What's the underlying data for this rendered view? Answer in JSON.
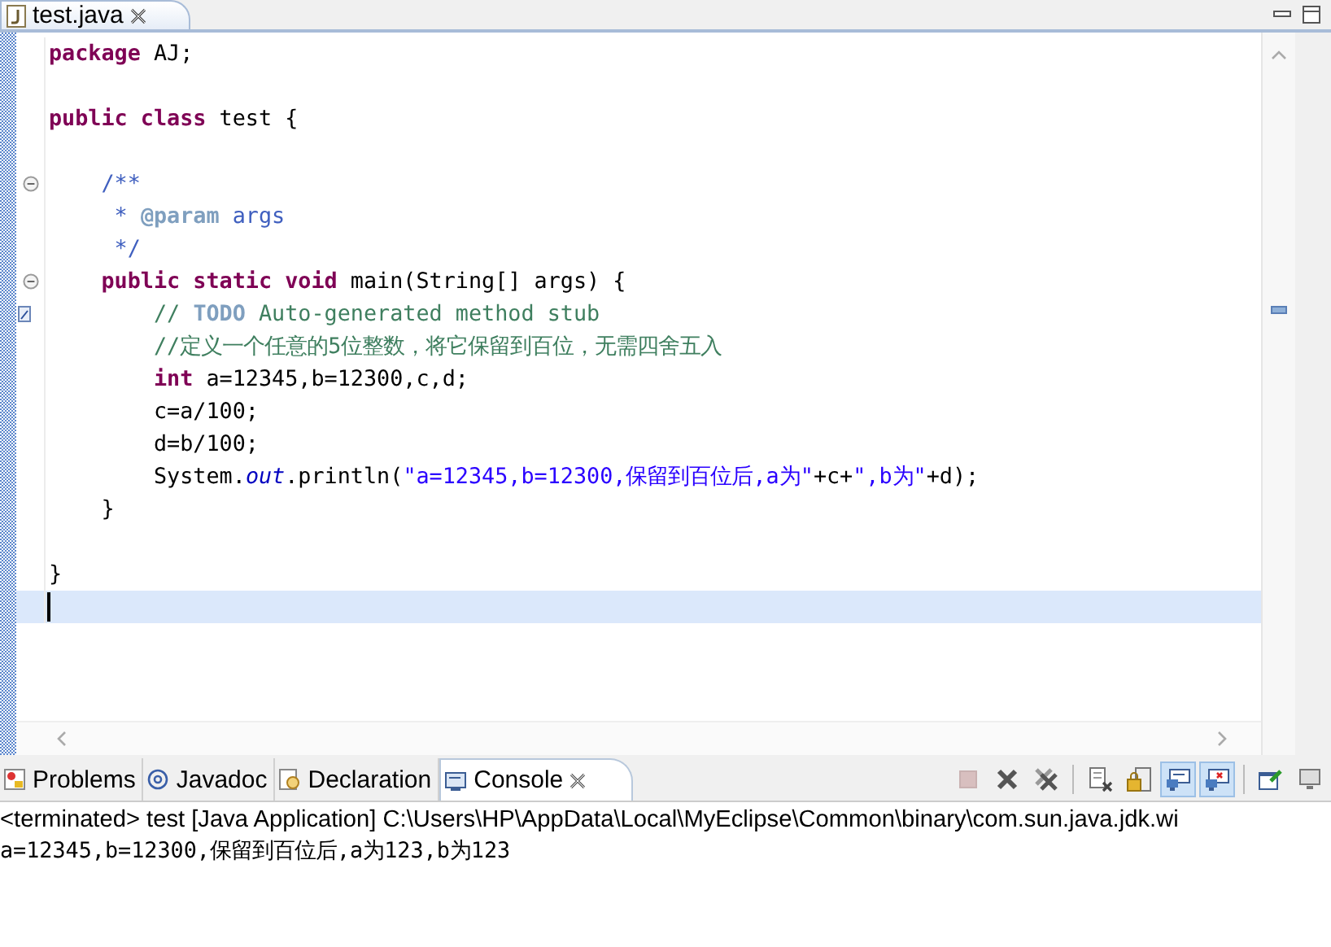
{
  "editor_tab": {
    "title": "test.java"
  },
  "code_lines": [
    {
      "fold": false,
      "current": false,
      "changed": false,
      "segments": [
        {
          "kind": "keyword",
          "text": "package"
        },
        {
          "kind": "plain",
          "text": " AJ;"
        }
      ]
    },
    {
      "fold": false,
      "current": false,
      "changed": false
    },
    {
      "fold": false,
      "current": false,
      "changed": false,
      "segments": [
        {
          "kind": "keyword",
          "text": "public class"
        },
        {
          "kind": "plain",
          "text": " test {"
        }
      ]
    },
    {
      "fold": false,
      "current": false,
      "changed": false
    },
    {
      "fold": true,
      "current": false,
      "changed": false,
      "segments": [
        {
          "kind": "javadoc",
          "text": "    /**"
        }
      ]
    },
    {
      "fold": false,
      "current": false,
      "changed": false,
      "segments": [
        {
          "kind": "javadoc",
          "text": "     * "
        },
        {
          "kind": "tag",
          "text": "@param"
        },
        {
          "kind": "javadoc",
          "text": " args"
        }
      ]
    },
    {
      "fold": false,
      "current": false,
      "changed": false,
      "segments": [
        {
          "kind": "javadoc",
          "text": "     */"
        }
      ]
    },
    {
      "fold": true,
      "current": false,
      "changed": false,
      "segments": [
        {
          "kind": "keyword",
          "text": "    public static void"
        },
        {
          "kind": "plain",
          "text": " main(String[] args) {"
        }
      ]
    },
    {
      "fold": false,
      "current": false,
      "changed": true,
      "segments": [
        {
          "kind": "comment",
          "text": "        // "
        },
        {
          "kind": "tag",
          "text": "TODO"
        },
        {
          "kind": "comment",
          "text": " Auto-generated method stub"
        }
      ]
    },
    {
      "fold": false,
      "current": false,
      "changed": false,
      "segments": [
        {
          "kind": "comment",
          "text": "        //定义一个任意的5位整数，将它保留到百位，无需四舍五入"
        }
      ]
    },
    {
      "fold": false,
      "current": false,
      "changed": false,
      "segments": [
        {
          "kind": "keyword",
          "text": "        int"
        },
        {
          "kind": "plain",
          "text": " a=12345,b=12300,c,d;"
        }
      ]
    },
    {
      "fold": false,
      "current": false,
      "changed": false,
      "segments": [
        {
          "kind": "plain",
          "text": "        c=a/100;"
        }
      ]
    },
    {
      "fold": false,
      "current": false,
      "changed": false,
      "segments": [
        {
          "kind": "plain",
          "text": "        d=b/100;"
        }
      ]
    },
    {
      "fold": false,
      "current": false,
      "changed": false,
      "segments": [
        {
          "kind": "plain",
          "text": "        System."
        },
        {
          "kind": "field",
          "text": "out"
        },
        {
          "kind": "plain",
          "text": ".println("
        },
        {
          "kind": "string",
          "text": "\"a=12345,b=12300,保留到百位后,a为\""
        },
        {
          "kind": "plain",
          "text": "+c+"
        },
        {
          "kind": "string",
          "text": "\",b为\""
        },
        {
          "kind": "plain",
          "text": "+d);"
        }
      ]
    },
    {
      "fold": false,
      "current": false,
      "changed": false,
      "segments": [
        {
          "kind": "plain",
          "text": "    }"
        }
      ]
    },
    {
      "fold": false,
      "current": false,
      "changed": false
    },
    {
      "fold": false,
      "current": false,
      "changed": false,
      "segments": [
        {
          "kind": "plain",
          "text": "}"
        }
      ]
    },
    {
      "fold": false,
      "current": true,
      "changed": false
    }
  ],
  "panel_tabs": [
    {
      "label": "Problems",
      "kind": "problems",
      "selected": false
    },
    {
      "label": "Javadoc",
      "kind": "javadoc",
      "selected": false
    },
    {
      "label": "Declaration",
      "kind": "declaration",
      "selected": false
    },
    {
      "label": "Console",
      "kind": "console",
      "selected": true
    }
  ],
  "console_toolbar": [
    {
      "kind": "stop",
      "pressed": false,
      "disabled": true
    },
    {
      "kind": "remove",
      "pressed": false,
      "disabled": false
    },
    {
      "kind": "remove-all",
      "pressed": false,
      "disabled": false
    },
    {
      "kind": "clear",
      "pressed": false,
      "disabled": false
    },
    {
      "kind": "lock",
      "pressed": false,
      "disabled": false
    },
    {
      "kind": "stdout",
      "pressed": true,
      "disabled": false
    },
    {
      "kind": "stderr",
      "pressed": true,
      "disabled": false
    },
    {
      "kind": "pin",
      "pressed": false,
      "disabled": false
    },
    {
      "kind": "monitor",
      "pressed": false,
      "disabled": false
    }
  ],
  "console_header": "<terminated> test [Java Application] C:\\Users\\HP\\AppData\\Local\\MyEclipse\\Common\\binary\\com.sun.java.jdk.wi",
  "console_output": [
    "a=12345,b=12300,保留到百位后,a为123,b为123"
  ]
}
